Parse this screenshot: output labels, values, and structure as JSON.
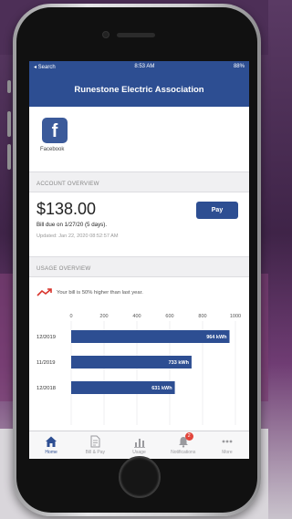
{
  "status_bar": {
    "carrier": "◂ Search",
    "time": "8:53 AM",
    "battery": "88%"
  },
  "nav": {
    "title": "Runestone Electric Association"
  },
  "social": {
    "facebook_label": "Facebook"
  },
  "account": {
    "section_title": "ACCOUNT OVERVIEW",
    "amount": "$138.00",
    "due_text": "Bill due on 1/27/20 (5 days).",
    "updated_text": "Updated: Jan 22, 2020 08:52:57 AM",
    "pay_label": "Pay"
  },
  "usage": {
    "section_title": "USAGE OVERVIEW",
    "comparison_text": "Your bill is 50% higher than last year."
  },
  "chart_data": {
    "type": "bar",
    "orientation": "horizontal",
    "categories": [
      "12/2019",
      "11/2019",
      "12/2018"
    ],
    "values": [
      964,
      733,
      631
    ],
    "value_labels": [
      "964 kWh",
      "733 kWh",
      "631 kWh"
    ],
    "xticks": [
      "0",
      "200",
      "400",
      "600",
      "800",
      "1000"
    ],
    "xlim": [
      0,
      1000
    ],
    "grid": true,
    "bar_color": "#2d4e92"
  },
  "tabs": [
    {
      "label": "Home",
      "icon": "home-icon",
      "active": true
    },
    {
      "label": "Bill & Pay",
      "icon": "bill-icon",
      "active": false
    },
    {
      "label": "Usage",
      "icon": "usage-chart-icon",
      "active": false
    },
    {
      "label": "Notifications",
      "icon": "bell-icon",
      "active": false,
      "badge": "2"
    },
    {
      "label": "More",
      "icon": "more-icon",
      "active": false
    }
  ],
  "colors": {
    "brand": "#2d4e92",
    "facebook": "#3b5a9a",
    "trend_red": "#d8342c",
    "badge": "#e2463c"
  }
}
